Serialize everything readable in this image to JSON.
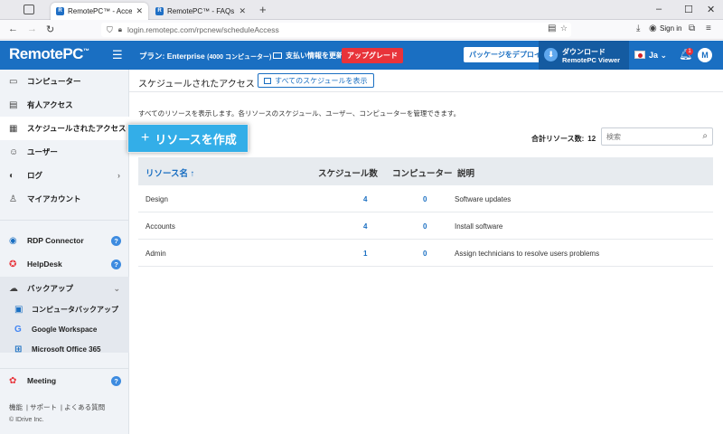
{
  "browser": {
    "tabs": [
      {
        "title": "RemotePC™ - Acceso programa",
        "active": true
      },
      {
        "title": "RemotePC™ - FAQs on Remote",
        "active": false
      }
    ],
    "url": "login.remotepc.com/rpcnew/scheduleAccess",
    "signin_label": "Sign in"
  },
  "header": {
    "logo": "RemotePC",
    "logo_tm": "™",
    "plan_label": "プラン: Enterprise",
    "plan_detail": "(4000 コンピューター)",
    "billing_label": "支払い情報を更新",
    "upgrade_label": "アップグレード",
    "deploy_label": "パッケージをデプロイ",
    "download_line1": "ダウンロード",
    "download_line2": "RemotePC Viewer",
    "language": "Ja",
    "notification_count": "1",
    "avatar_letter": "M"
  },
  "sidebar": {
    "items": [
      {
        "label": "コンピューター",
        "icon": "monitor-icon"
      },
      {
        "label": "有人アクセス",
        "icon": "inbox-icon"
      },
      {
        "label": "スケジュールされたアクセス",
        "icon": "calendar-clock-icon"
      },
      {
        "label": "ユーザー",
        "icon": "users-icon"
      },
      {
        "label": "ログ",
        "icon": "log-icon"
      },
      {
        "label": "マイアカウント",
        "icon": "user-icon"
      }
    ],
    "rdp_label": "RDP Connector",
    "helpdesk_label": "HelpDesk",
    "backup_label": "バックアップ",
    "backup_items": [
      {
        "label": "コンピュータバックアップ",
        "icon": "computer-backup-icon"
      },
      {
        "label": "Google Workspace",
        "icon": "google-icon"
      },
      {
        "label": "Microsoft Office 365",
        "icon": "windows-icon"
      }
    ],
    "meeting_label": "Meeting",
    "footer_links": [
      "機能",
      "サポート",
      "よくある質問"
    ],
    "copyright": "© IDrive Inc."
  },
  "main": {
    "title": "スケジュールされたアクセス",
    "view_all_label": "すべてのスケジュールを表示",
    "description": "すべてのリソースを表示します。各リソースのスケジュール、ユーザー、コンピューターを管理できます。",
    "create_label": "リソースを作成",
    "total_label": "合計リソース数:",
    "total_value": "12",
    "search_placeholder": "検索",
    "columns": [
      "リソース名",
      "スケジュール数",
      "コンピューター",
      "説明"
    ],
    "sort_arrow": "↑",
    "rows": [
      {
        "name": "Design",
        "schedules": "4",
        "computers": "0",
        "description": "Software updates"
      },
      {
        "name": "Accounts",
        "schedules": "4",
        "computers": "0",
        "description": "Install software"
      },
      {
        "name": "Admin",
        "schedules": "1",
        "computers": "0",
        "description": "Assign technicians to resolve users problems"
      }
    ]
  },
  "colors": {
    "brand": "#1a6fc2",
    "accent": "#33aee8",
    "upgrade": "#e8333a"
  }
}
